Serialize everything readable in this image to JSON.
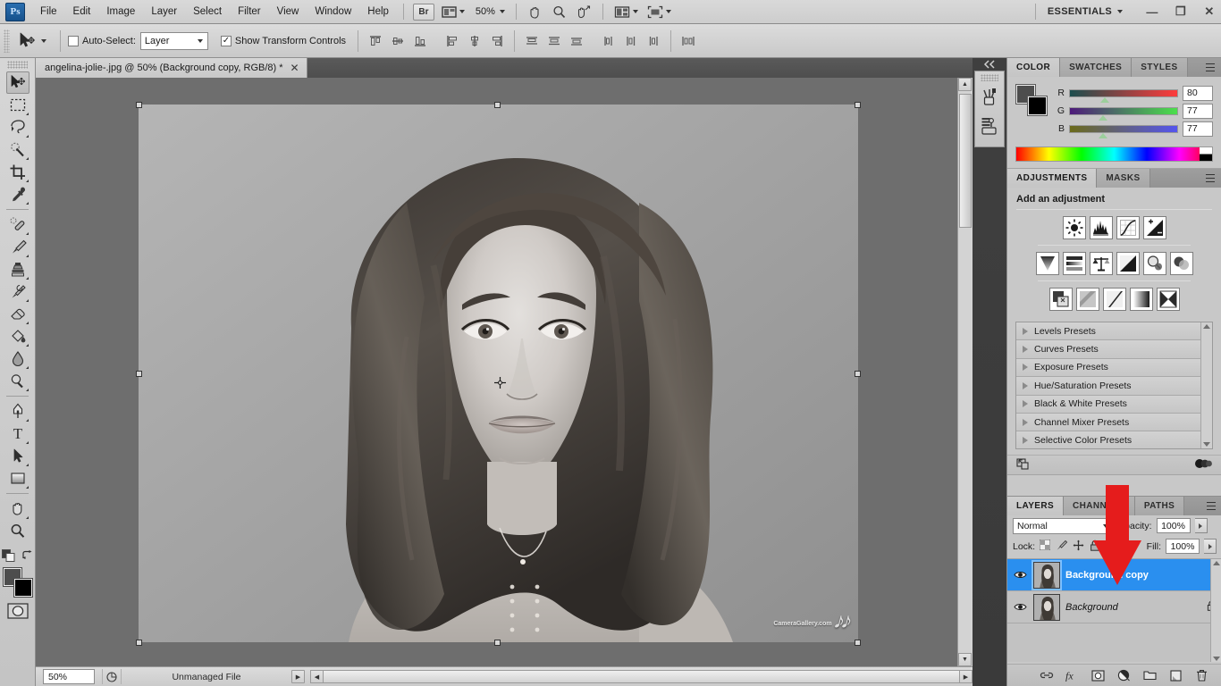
{
  "app": {
    "name": "Ps",
    "workspace": "ESSENTIALS",
    "zoom_level": "50%"
  },
  "menubar": {
    "items": [
      "File",
      "Edit",
      "Image",
      "Layer",
      "Select",
      "Filter",
      "View",
      "Window",
      "Help"
    ],
    "bridge_label": "Br",
    "window_controls": {
      "minimize": "—",
      "restore": "❐",
      "close": "✕"
    }
  },
  "options_bar": {
    "tool": "move-tool",
    "auto_select_label": "Auto-Select:",
    "auto_select_checked": false,
    "auto_select_value": "Layer",
    "show_transform_label": "Show Transform Controls",
    "show_transform_checked": true,
    "align_buttons": [
      "align-top-edges",
      "align-vertical-centers",
      "align-bottom-edges",
      "align-left-edges",
      "align-horizontal-centers",
      "align-right-edges"
    ],
    "distribute_buttons": [
      "distribute-top-edges",
      "distribute-vertical-centers",
      "distribute-bottom-edges",
      "distribute-left-edges",
      "distribute-horizontal-centers",
      "distribute-right-edges"
    ],
    "auto_align_button": "auto-align-layers"
  },
  "toolbar": {
    "tools": [
      {
        "name": "move-tool",
        "active": true,
        "has_flyout": false
      },
      {
        "name": "rectangular-marquee-tool",
        "active": false,
        "has_flyout": true
      },
      {
        "name": "lasso-tool",
        "active": false,
        "has_flyout": true
      },
      {
        "name": "quick-selection-tool",
        "active": false,
        "has_flyout": true
      },
      {
        "name": "crop-tool",
        "active": false,
        "has_flyout": true
      },
      {
        "name": "eyedropper-tool",
        "active": false,
        "has_flyout": true
      },
      {
        "name": "spot-healing-brush-tool",
        "active": false,
        "has_flyout": true
      },
      {
        "name": "brush-tool",
        "active": false,
        "has_flyout": true
      },
      {
        "name": "clone-stamp-tool",
        "active": false,
        "has_flyout": true
      },
      {
        "name": "history-brush-tool",
        "active": false,
        "has_flyout": true
      },
      {
        "name": "eraser-tool",
        "active": false,
        "has_flyout": true
      },
      {
        "name": "gradient-tool",
        "active": false,
        "has_flyout": true
      },
      {
        "name": "blur-tool",
        "active": false,
        "has_flyout": true
      },
      {
        "name": "dodge-tool",
        "active": false,
        "has_flyout": true
      },
      {
        "name": "pen-tool",
        "active": false,
        "has_flyout": true
      },
      {
        "name": "horizontal-type-tool",
        "active": false,
        "has_flyout": true
      },
      {
        "name": "path-selection-tool",
        "active": false,
        "has_flyout": true
      },
      {
        "name": "rectangle-shape-tool",
        "active": false,
        "has_flyout": true
      },
      {
        "name": "hand-tool",
        "active": false,
        "has_flyout": true
      },
      {
        "name": "zoom-tool",
        "active": false,
        "has_flyout": false
      }
    ],
    "foreground_color": "#4d4d4d",
    "background_color": "#000000",
    "quick_mask": "edit-in-quick-mask-mode"
  },
  "document": {
    "tab_title": "angelina-jolie-.jpg @ 50% (Background copy, RGB/8) *",
    "close_glyph": "✕",
    "watermark": "CameraGallery.com",
    "transform_controls_visible": true
  },
  "status_bar": {
    "zoom": "50%",
    "doc_info": "Unmanaged File"
  },
  "color_panel": {
    "tabs": [
      "COLOR",
      "SWATCHES",
      "STYLES"
    ],
    "active_tab": "COLOR",
    "channels": [
      {
        "label": "R",
        "value": "80"
      },
      {
        "label": "G",
        "value": "77"
      },
      {
        "label": "B",
        "value": "77"
      }
    ],
    "foreground": "#4d4d4d",
    "background": "#000000"
  },
  "adjustments_panel": {
    "tabs": [
      "ADJUSTMENTS",
      "MASKS"
    ],
    "active_tab": "ADJUSTMENTS",
    "title": "Add an adjustment",
    "row1": [
      "brightness-contrast-icon",
      "levels-icon",
      "curves-icon",
      "exposure-icon"
    ],
    "row2": [
      "vibrance-icon",
      "hue-saturation-icon",
      "color-balance-icon",
      "black-white-icon",
      "photo-filter-icon",
      "channel-mixer-icon"
    ],
    "row3": [
      "invert-icon",
      "posterize-icon",
      "threshold-icon",
      "gradient-map-icon",
      "selective-color-icon"
    ],
    "presets": [
      "Levels Presets",
      "Curves Presets",
      "Exposure Presets",
      "Hue/Saturation Presets",
      "Black & White Presets",
      "Channel Mixer Presets",
      "Selective Color Presets"
    ],
    "footer_left": "return-to-adjustment-list-icon",
    "footer_right": "toggle-layer-visibility-icon"
  },
  "layers_panel": {
    "tabs": [
      "LAYERS",
      "CHANNELS",
      "PATHS"
    ],
    "active_tab": "LAYERS",
    "blend_mode": "Normal",
    "opacity_label": "Opacity:",
    "opacity_value": "100%",
    "lock_label": "Lock:",
    "lock_buttons": [
      "lock-transparent-pixels-icon",
      "lock-image-pixels-icon",
      "lock-position-icon",
      "lock-all-icon"
    ],
    "fill_label": "Fill:",
    "fill_value": "100%",
    "layers": [
      {
        "name": "Background copy",
        "selected": true,
        "visible": true,
        "locked": false,
        "italic": false
      },
      {
        "name": "Background",
        "selected": false,
        "visible": true,
        "locked": true,
        "italic": true
      }
    ],
    "footer_buttons": [
      "link-layers-icon",
      "add-layer-style-icon",
      "add-layer-mask-icon",
      "new-adjustment-layer-icon",
      "new-group-icon",
      "new-layer-icon",
      "delete-layer-icon"
    ]
  },
  "mini_dock": {
    "collapse": "collapse-panels-icon",
    "buttons": [
      "brush-panel-icon",
      "history-panel-icon"
    ]
  },
  "annotation": {
    "type": "red-arrow",
    "color": "#e51c1c",
    "points_to": "Background copy"
  }
}
